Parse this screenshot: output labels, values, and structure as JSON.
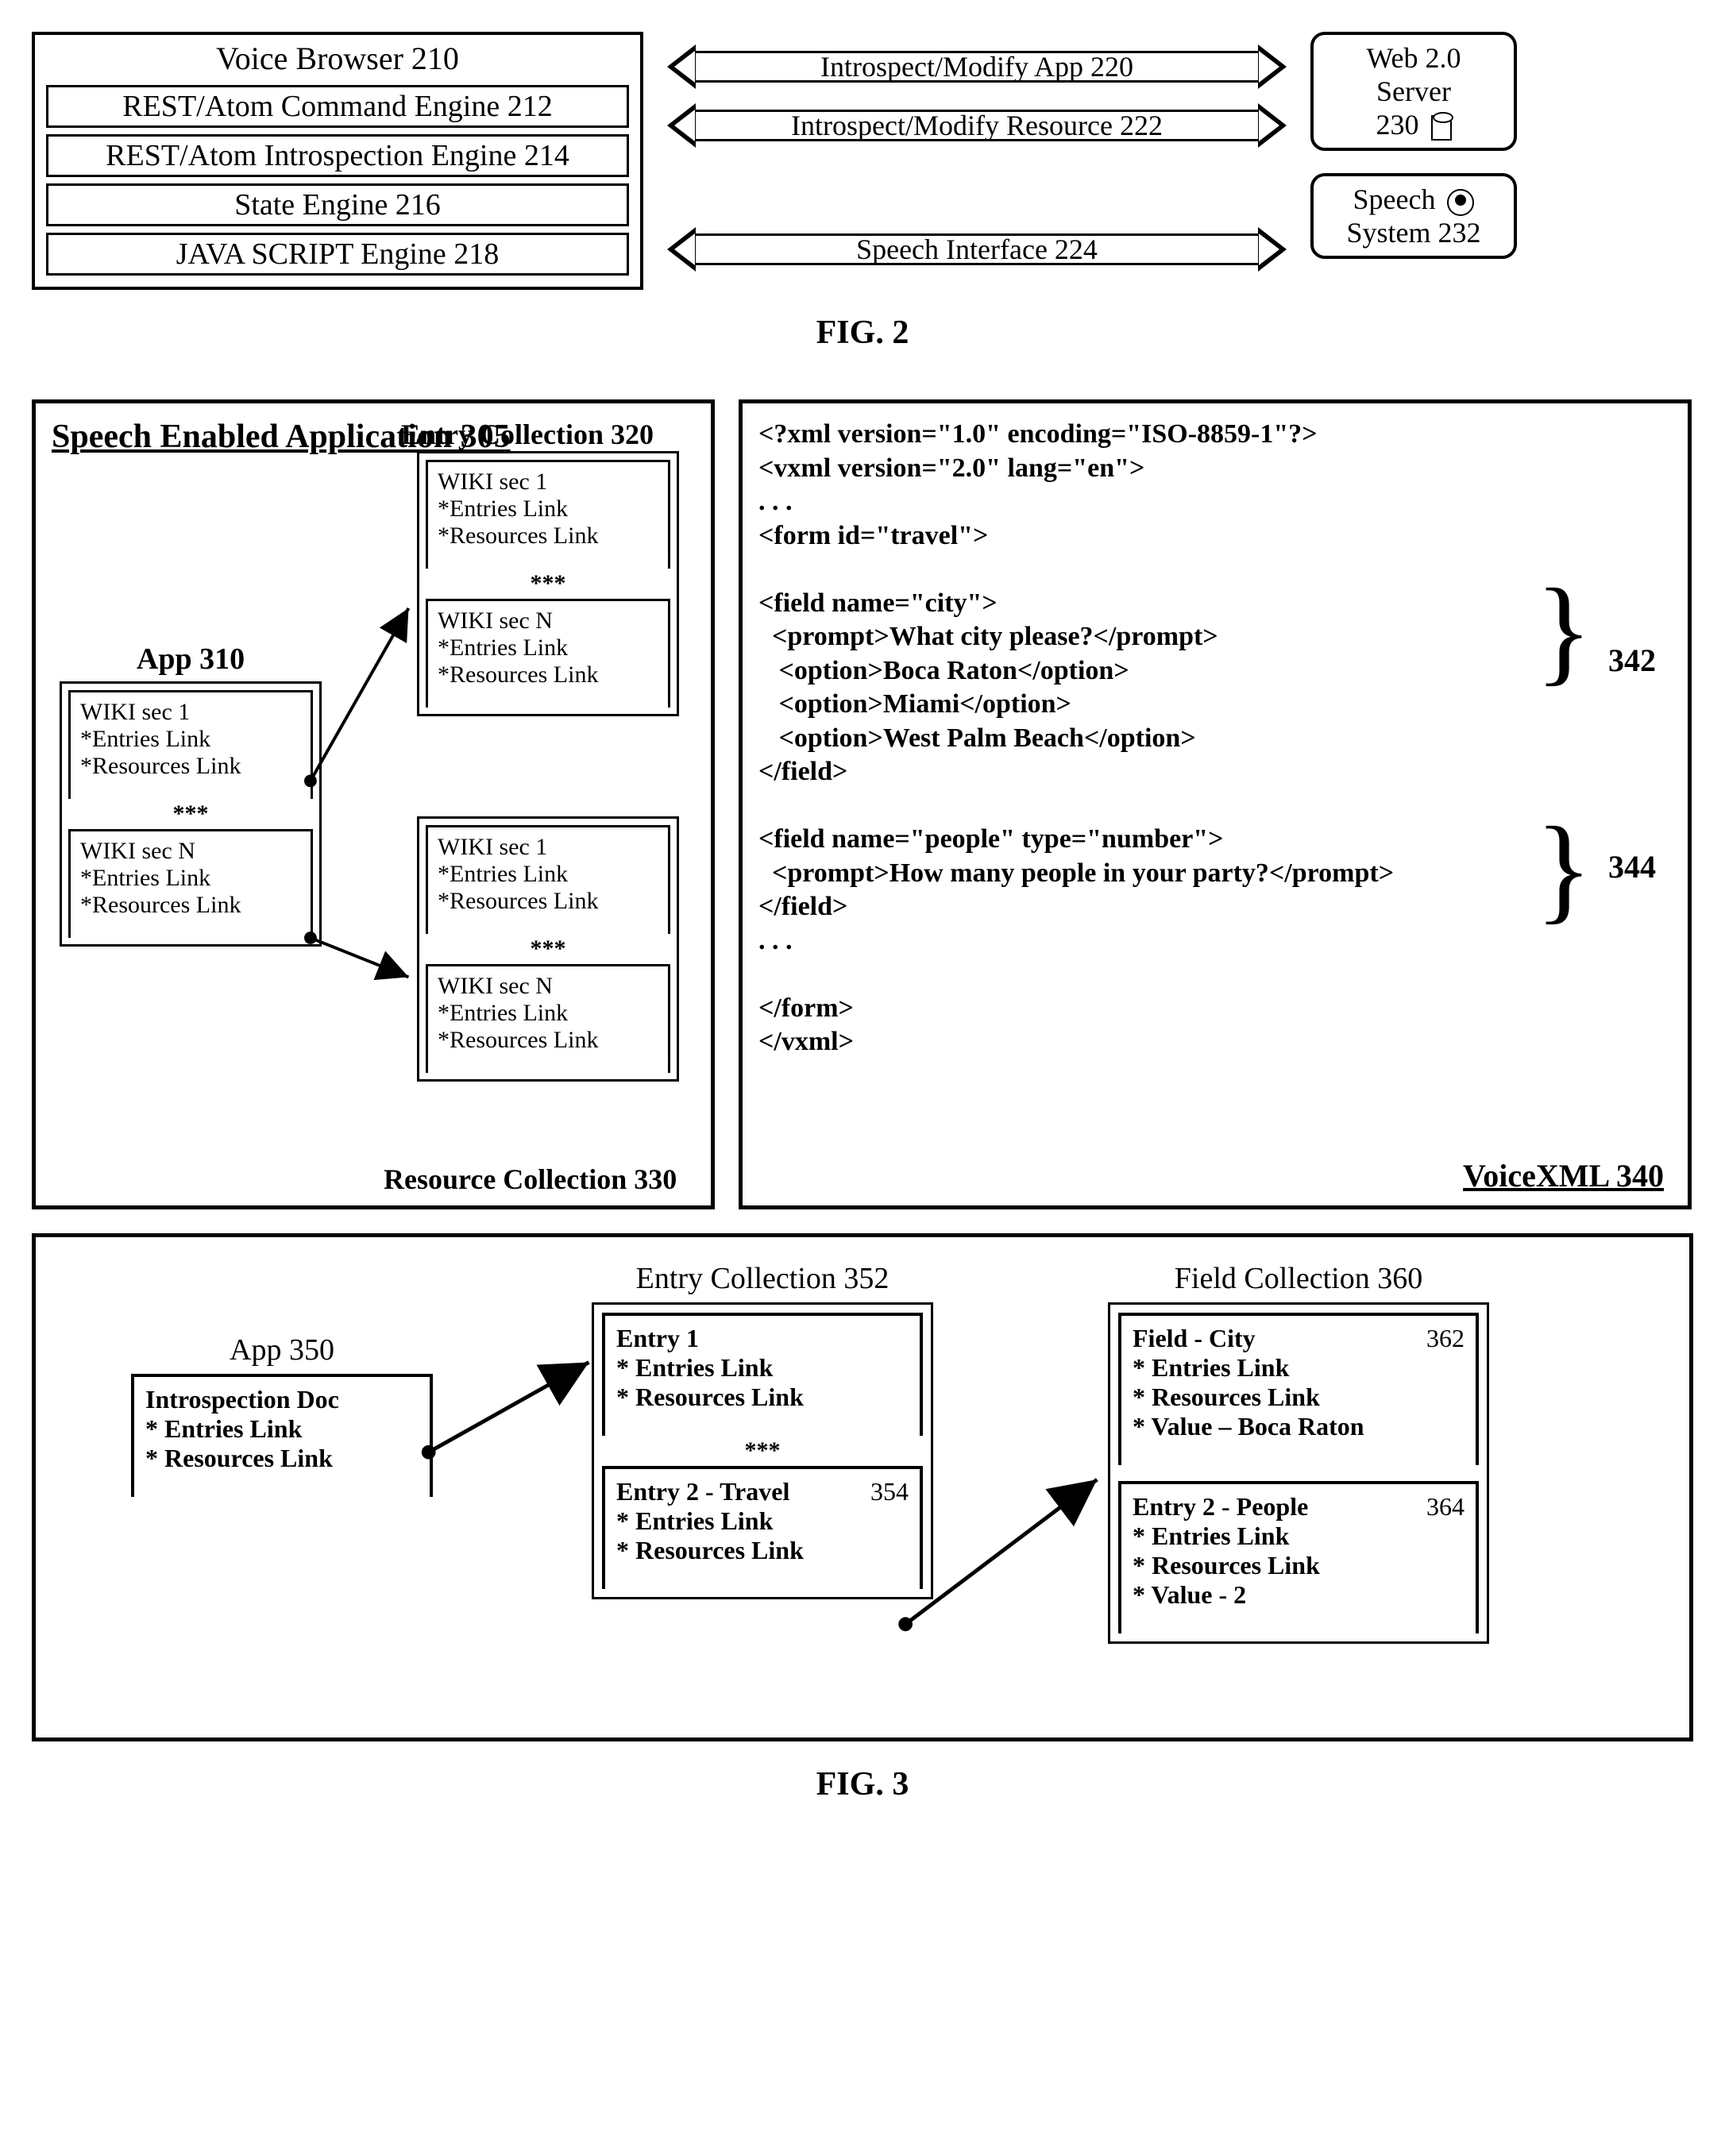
{
  "fig2": {
    "voiceBrowser": {
      "title": "Voice Browser 210",
      "rows": [
        "REST/Atom Command Engine 212",
        "REST/Atom Introspection Engine 214",
        "State Engine 216",
        "JAVA SCRIPT Engine 218"
      ]
    },
    "arrows": [
      "Introspect/Modify App 220",
      "Introspect/Modify Resource 222",
      "Speech Interface 224"
    ],
    "webServer": {
      "line1": "Web 2.0",
      "line2": "Server",
      "line3": "230"
    },
    "speechSystem": {
      "line1": "Speech",
      "line2": "System 232"
    },
    "caption": "FIG. 2"
  },
  "fig3": {
    "leftPanel": {
      "title": "Speech Enabled Application 305",
      "entryCollectionLabel": "Entry Collection 320",
      "resourceCollectionLabel": "Resource Collection 330",
      "appLabel": "App 310",
      "wikiSec1": "WIKI sec 1",
      "wikiSecN": "WIKI sec N",
      "entriesLink": "*Entries Link",
      "resourcesLink": "*Resources Link",
      "stars": "***"
    },
    "rightPanel": {
      "title": "VoiceXML 340",
      "ref342": "342",
      "ref344": "344",
      "code_l1": "<?xml version=\"1.0\" encoding=\"ISO-8859-1\"?>",
      "code_l2": "<vxml version=\"2.0\" lang=\"en\">",
      "code_l3": ". . .",
      "code_l4": "<form id=\"travel\">",
      "code_l5": "",
      "code_l6": "<field name=\"city\">",
      "code_l7": "  <prompt>What city please?</prompt>",
      "code_l8": "   <option>Boca Raton</option>",
      "code_l9": "   <option>Miami</option>",
      "code_l10": "   <option>West Palm Beach</option>",
      "code_l11": "</field>",
      "code_l12": "",
      "code_l13": "<field name=\"people\" type=\"number\">",
      "code_l14": "  <prompt>How many people in your party?</prompt>",
      "code_l15": "</field>",
      "code_l16": ". . .",
      "code_l17": "",
      "code_l18": "</form>",
      "code_l19": "</vxml>"
    },
    "bottomPanel": {
      "appLabel": "App 350",
      "entryCollectionLabel": "Entry Collection 352",
      "fieldCollectionLabel": "Field Collection 360",
      "appDoc": {
        "l1": "Introspection Doc",
        "l2": "* Entries Link",
        "l3": "* Resources Link"
      },
      "entry1": {
        "title": "Entry 1",
        "l2": "* Entries Link",
        "l3": "* Resources Link"
      },
      "stars": "***",
      "entry2": {
        "ref": "354",
        "title": "Entry 2 - Travel",
        "l2": "* Entries Link",
        "l3": "* Resources Link"
      },
      "field1": {
        "ref": "362",
        "title": "Field - City",
        "l2": "* Entries Link",
        "l3": "* Resources Link",
        "l4": "* Value – Boca Raton"
      },
      "field2": {
        "ref": "364",
        "title": "Entry 2 - People",
        "l2": "* Entries Link",
        "l3": "* Resources Link",
        "l4": "* Value - 2"
      }
    },
    "caption": "FIG. 3"
  }
}
